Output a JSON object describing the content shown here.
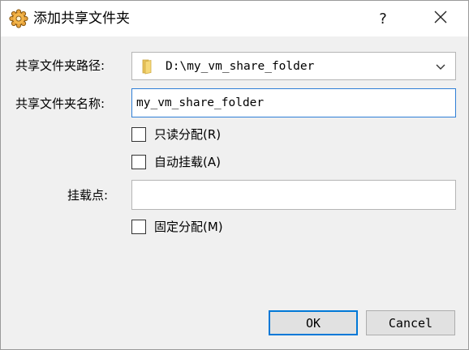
{
  "window": {
    "title": "添加共享文件夹",
    "help_glyph": "?",
    "app_icon": "virtualbox-gear-icon",
    "close_icon": "close-icon"
  },
  "form": {
    "path_label": "共享文件夹路径:",
    "path_value": "D:\\my_vm_share_folder",
    "path_icon": "folder-icon",
    "name_label": "共享文件夹名称:",
    "name_value": "my_vm_share_folder",
    "readonly_label": "只读分配(R)",
    "readonly_checked": false,
    "automount_label": "自动挂载(A)",
    "automount_checked": false,
    "mountpoint_label": "挂载点:",
    "mountpoint_value": "",
    "permanent_label": "固定分配(M)",
    "permanent_checked": false
  },
  "buttons": {
    "ok": "OK",
    "cancel": "Cancel"
  },
  "colors": {
    "focus_border": "#2f7fd6",
    "default_button_border": "#0078d7",
    "dialog_background": "#f0f0f0"
  }
}
